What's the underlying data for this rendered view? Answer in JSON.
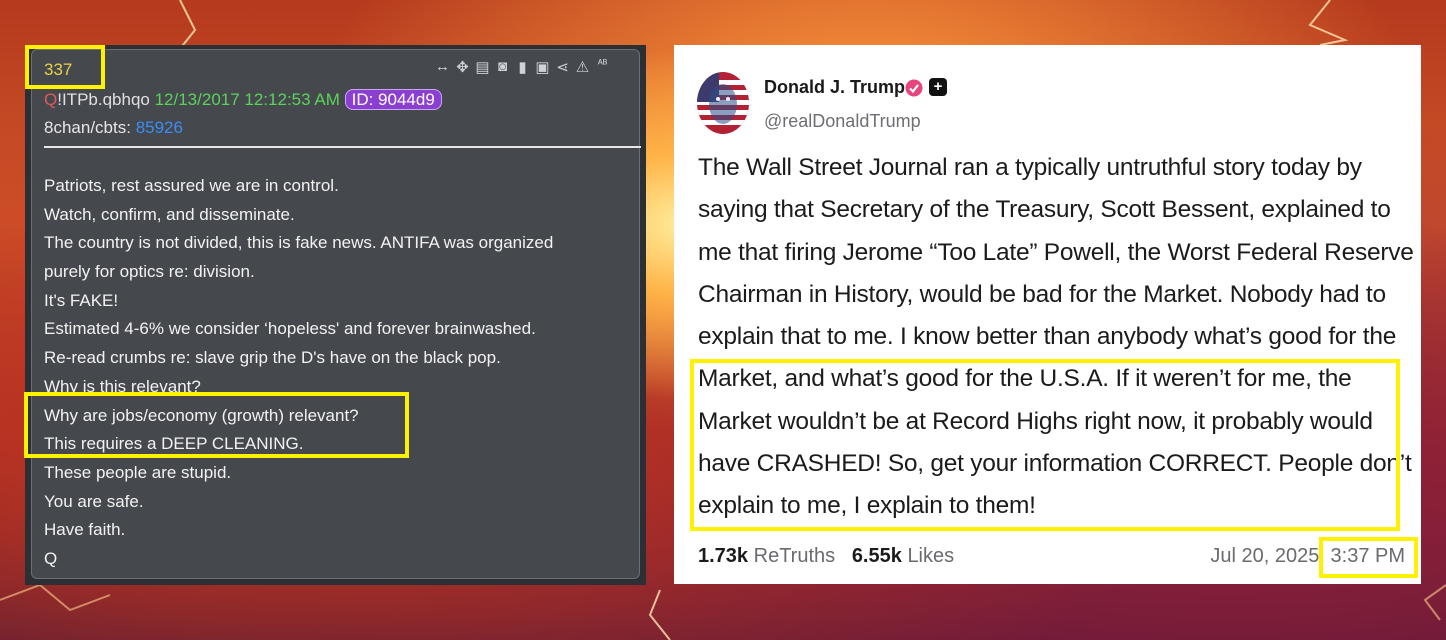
{
  "q_post": {
    "post_number": "337",
    "trip_q": "Q",
    "tripcode": "!ITPb.qbhqo",
    "date": "12/13/2017 12:12:53 AM",
    "id_badge": "ID: 9044d9",
    "board_label": "8chan/cbts:",
    "board_thread": "85926",
    "toolbar_icons": [
      "resize-icon",
      "move-icon",
      "file-icon",
      "glasses-icon",
      "clipboard-icon",
      "clipboard-check-icon",
      "share-icon",
      "warning-icon",
      "spellcheck-icon"
    ],
    "lines": [
      "Patriots, rest assured we are in control.",
      "Watch, confirm, and disseminate.",
      "The country is not divided, this is fake news. ANTIFA was organized",
      "purely for optics re: division.",
      "It's FAKE!",
      "Estimated 4-6% we consider ‘hopeless' and forever brainwashed.",
      "Re-read crumbs re: slave grip the D's have on the black pop.",
      "Why is this relevant?",
      "Why are jobs/economy (growth) relevant?",
      "This requires a DEEP CLEANING.",
      "These people are stupid.",
      "You are safe.",
      "Have faith.",
      "Q"
    ]
  },
  "truth_post": {
    "display_name": "Donald J. Trump",
    "handle": "@realDonaldTrump",
    "lines": [
      "The Wall Street Journal ran a typically untruthful story today by",
      "saying that Secretary of the Treasury, Scott Bessent, explained to",
      "me that firing Jerome “Too Late” Powell, the Worst Federal Reserve",
      "Chairman in History, would be bad for the Market. Nobody had to",
      "explain that to me. I know better than anybody what’s good for the",
      "Market, and what’s good for the U.S.A. If it weren’t for me, the",
      "Market wouldn’t be at Record Highs right now, it probably would",
      "have CRASHED! So, get your information CORRECT. People don’t",
      "explain to me, I explain to them!"
    ],
    "retruths_count": "1.73k",
    "retruths_label": "ReTruths",
    "likes_count": "6.55k",
    "likes_label": "Likes",
    "date": "Jul 20, 2025,",
    "time": "3:37 PM"
  },
  "colors": {
    "highlight": "#fff200",
    "q_date_green": "#5bd35b",
    "q_link_blue": "#3b8cf5",
    "id_badge_purple": "#8a3fd1",
    "verified_pink": "#e8457a"
  }
}
